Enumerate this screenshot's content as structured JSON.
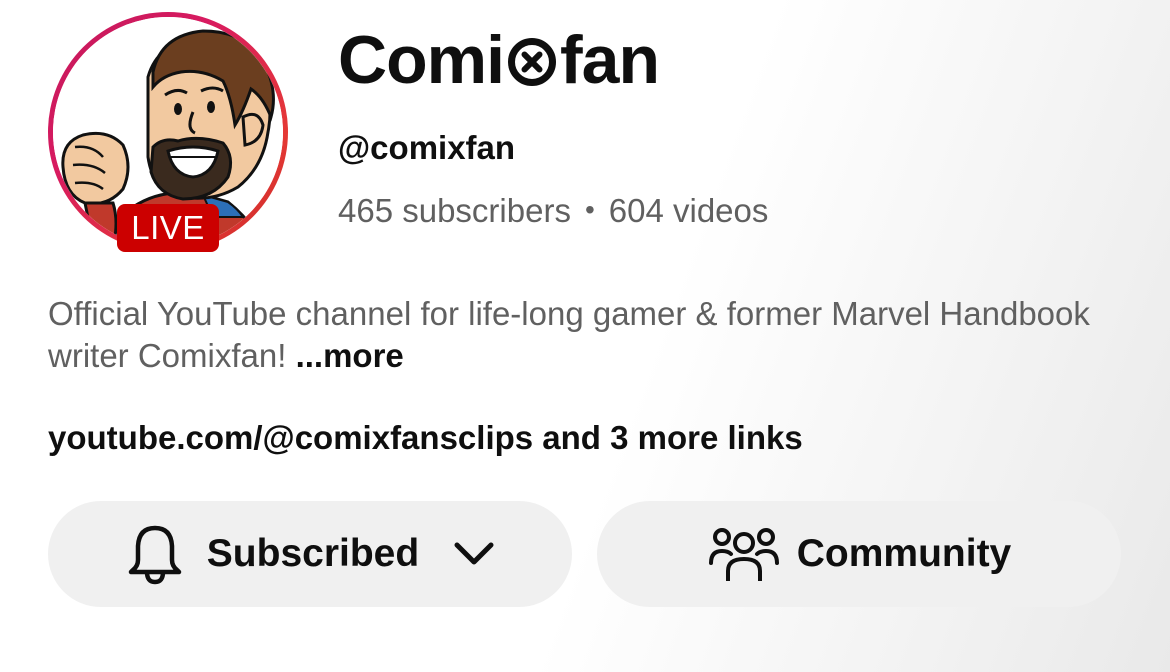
{
  "channel": {
    "name_left": "Comi",
    "name_right": "fan",
    "name_glyph_icon": "circle-x-icon",
    "handle": "@comixfan",
    "subscribers": "465 subscribers",
    "separator": "•",
    "videos": "604 videos",
    "description": "Official YouTube channel for life-long gamer & former Marvel Handbook writer Comixfan!",
    "more_label": "...more",
    "links_text": "youtube.com/@comixfansclips and 3 more links"
  },
  "avatar": {
    "live_label": "LIVE",
    "ring_color": "#d81b60",
    "live_color": "#cc0000"
  },
  "actions": {
    "subscribe_label": "Subscribed",
    "subscribe_icon": "bell-icon",
    "subscribe_menu_icon": "chevron-down-icon",
    "community_label": "Community",
    "community_icon": "people-icon"
  },
  "colors": {
    "primary_text": "#0f0f0f",
    "secondary_text": "#606060",
    "button_bg": "#f0f0f0"
  }
}
